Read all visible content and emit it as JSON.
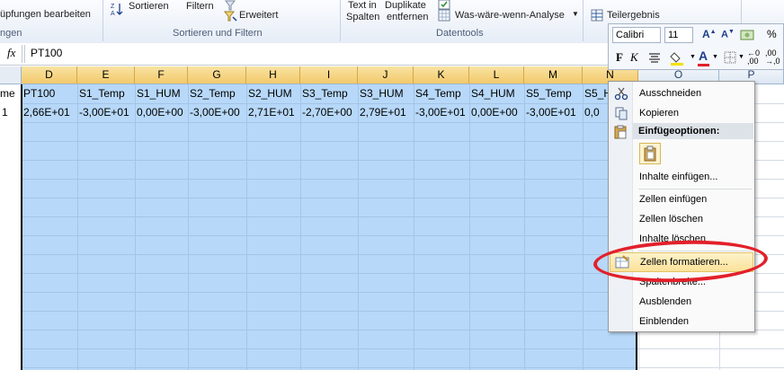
{
  "ribbon": {
    "truncated_left_top": "üpfungen bearbeiten",
    "truncated_left_group": "ngen",
    "sort_label": "Sortieren",
    "filter_label": "Filtern",
    "advanced_label": "Erweitert",
    "sort_filter_group": "Sortieren und Filtern",
    "text_in_columns_1": "Text in",
    "text_in_columns_2": "Spalten",
    "duplicates_1": "Duplikate",
    "duplicates_2": "entfernen",
    "what_if": "Was-wäre-wenn-Analyse",
    "data_tools_group": "Datentools",
    "subtotal": "Teilergebnis"
  },
  "mini_toolbar": {
    "font": "Calibri",
    "size": "11",
    "bold": "F",
    "percent": "%"
  },
  "formula_bar": {
    "fx": "fx",
    "content": "PT100"
  },
  "columns": [
    "D",
    "E",
    "F",
    "G",
    "H",
    "I",
    "J",
    "K",
    "L",
    "M",
    "N",
    "O",
    "P"
  ],
  "row_header_label": "me",
  "row_header_value": "1",
  "header_row": [
    "PT100",
    "S1_Temp",
    "S1_HUM",
    "S2_Temp",
    "S2_HUM",
    "S3_Temp",
    "S3_HUM",
    "S4_Temp",
    "S4_HUM",
    "S5_Temp",
    "S5_H"
  ],
  "value_row": [
    "2,66E+01",
    "-3,00E+01",
    "0,00E+00",
    "-3,00E+00",
    "2,71E+01",
    "-2,70E+00",
    "2,79E+01",
    "-3,00E+01",
    "0,00E+00",
    "-3,00E+01",
    "0,0"
  ],
  "context_menu": {
    "cut": "Ausschneiden",
    "copy": "Kopieren",
    "paste_options": "Einfügeoptionen:",
    "paste_special": "Inhalte einfügen...",
    "insert_cells": "Zellen einfügen",
    "delete_cells": "Zellen löschen",
    "clear_contents": "Inhalte löschen",
    "format_cells": "Zellen formatieren...",
    "column_width": "Spaltenbreite...",
    "hide": "Ausblenden",
    "unhide": "Einblenden"
  },
  "colors": {
    "selection": "#b7d8f8",
    "annotation_ring": "#e2202a",
    "highlight": "#fbe29a"
  }
}
